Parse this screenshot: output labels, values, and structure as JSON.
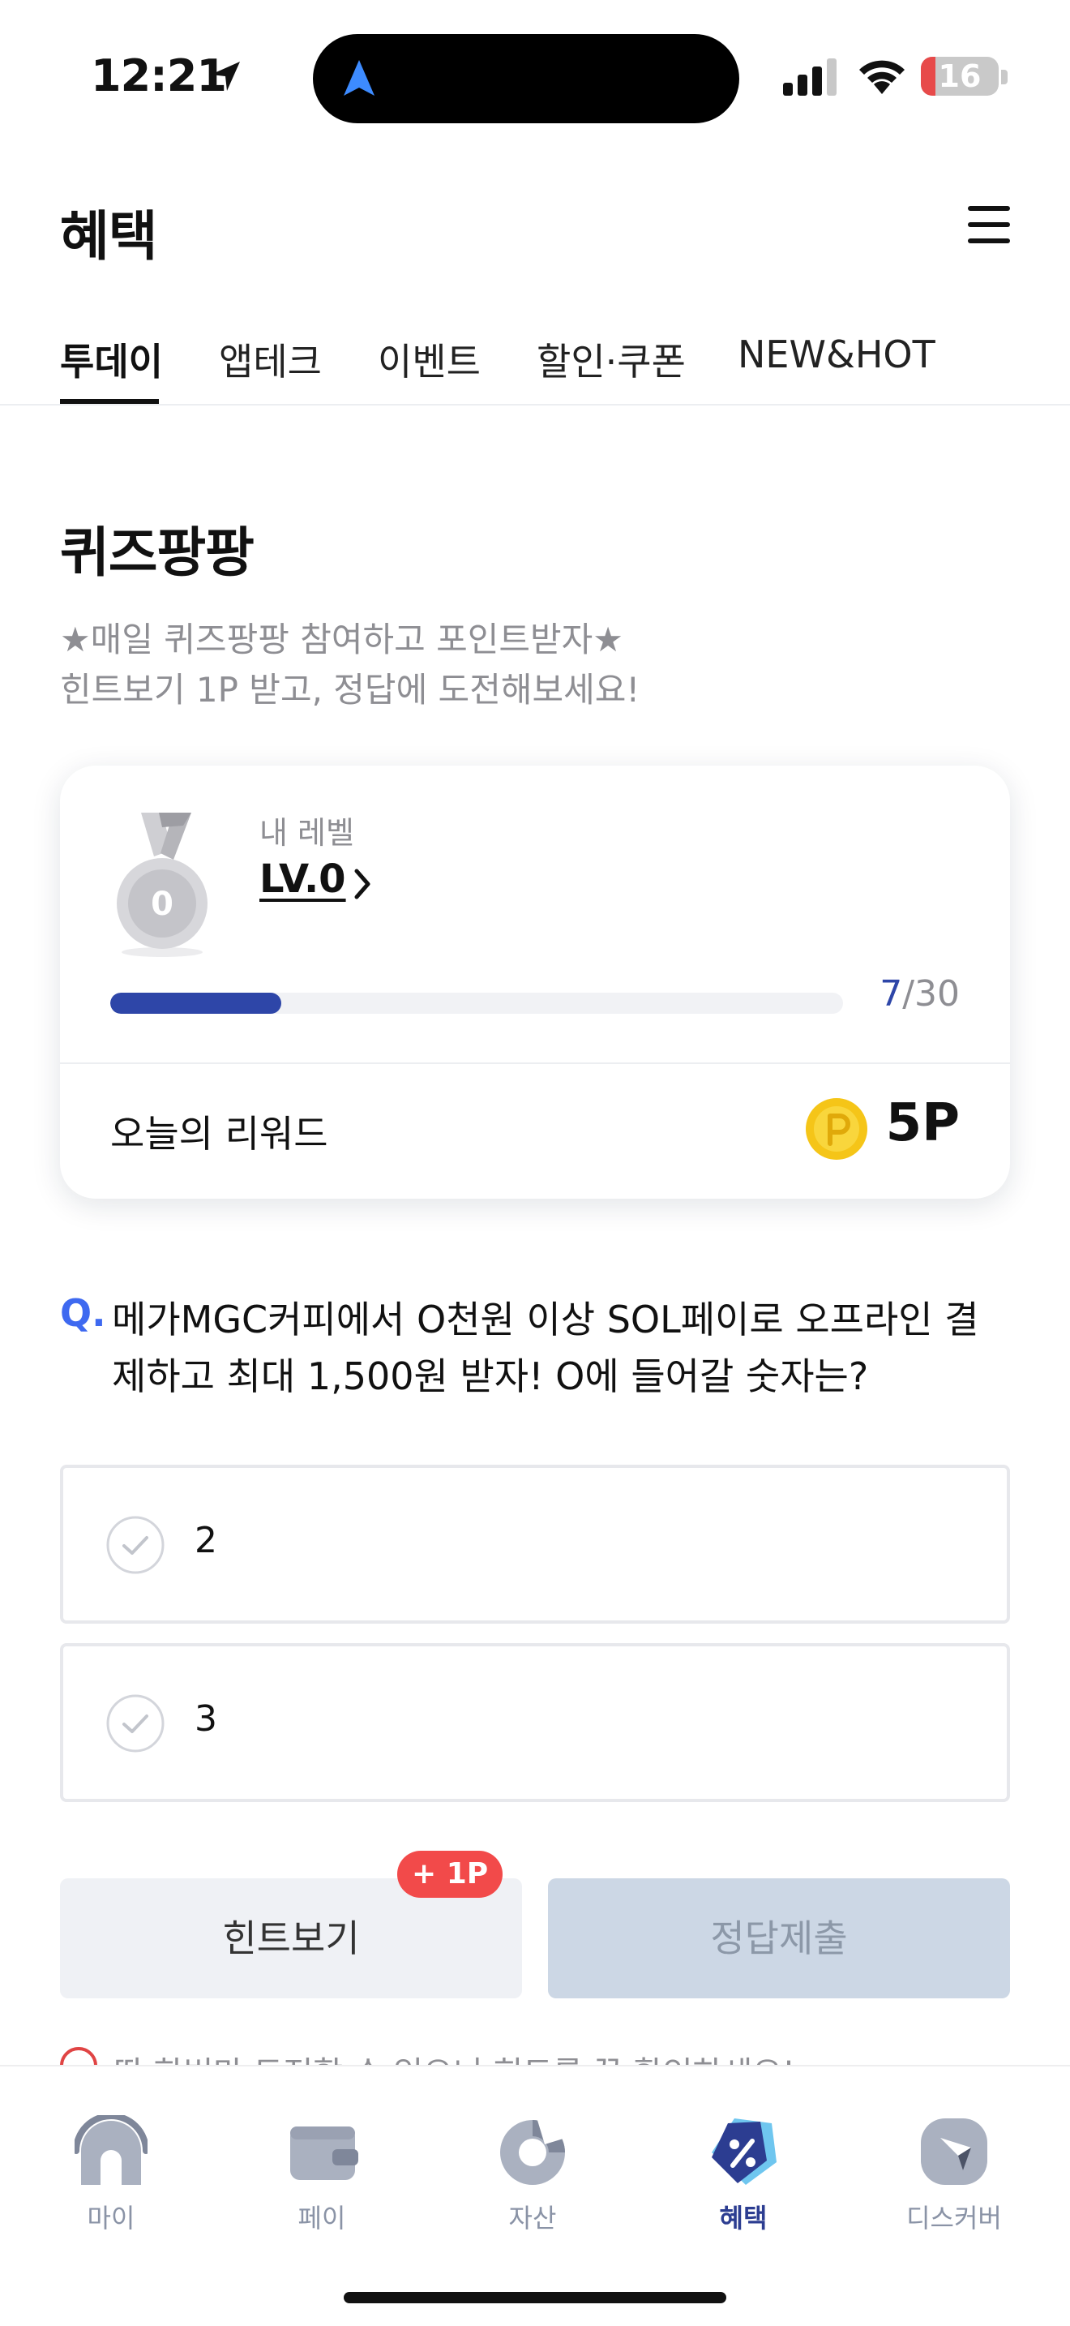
{
  "status_bar": {
    "time": "12:21",
    "battery": "16"
  },
  "header": {
    "title": "혜택"
  },
  "tabs": [
    {
      "label": "투데이",
      "active": true
    },
    {
      "label": "앱테크",
      "active": false
    },
    {
      "label": "이벤트",
      "active": false
    },
    {
      "label": "할인·쿠폰",
      "active": false
    },
    {
      "label": "NEW&HOT",
      "active": false
    }
  ],
  "quiz": {
    "title": "퀴즈팡팡",
    "desc_line1": "★매일 퀴즈팡팡 참여하고 포인트받자★",
    "desc_line2": "힌트보기 1P 받고, 정답에 도전해보세요!"
  },
  "level_card": {
    "level_label": "내 레벨",
    "level_value": "LV.0",
    "medal_number": "0",
    "progress_current": "7",
    "progress_total": "/30",
    "progress_fraction": 0.233,
    "reward_label": "오늘의 리워드",
    "reward_value": "5P"
  },
  "question": {
    "mark": "Q.",
    "text": "메가MGC커피에서 O천원 이상 SOL페이로 오프라인 결제하고 최대 1,500원 받자! O에 들어갈 숫자는?"
  },
  "options": [
    {
      "label": "2"
    },
    {
      "label": "3"
    }
  ],
  "buttons": {
    "hint": "힌트보기",
    "hint_badge": "+ 1P",
    "submit": "정답제출"
  },
  "warning": {
    "text": "딱 한번만 도전할 수 있으니 힌트를 꼭 확인하세요!"
  },
  "bottom_nav": [
    {
      "label": "마이",
      "icon": "home-icon",
      "active": false
    },
    {
      "label": "페이",
      "icon": "wallet-icon",
      "active": false
    },
    {
      "label": "자산",
      "icon": "pie-chart-icon",
      "active": false
    },
    {
      "label": "혜택",
      "icon": "benefit-tag-icon",
      "active": true
    },
    {
      "label": "디스커버",
      "icon": "compass-icon",
      "active": false
    }
  ],
  "colors": {
    "accent": "#2e46a8",
    "question_mark": "#3e69f0",
    "badge": "#f24a4a",
    "nav_active": "#2c3d91",
    "nav_inactive": "#8a93a6"
  }
}
